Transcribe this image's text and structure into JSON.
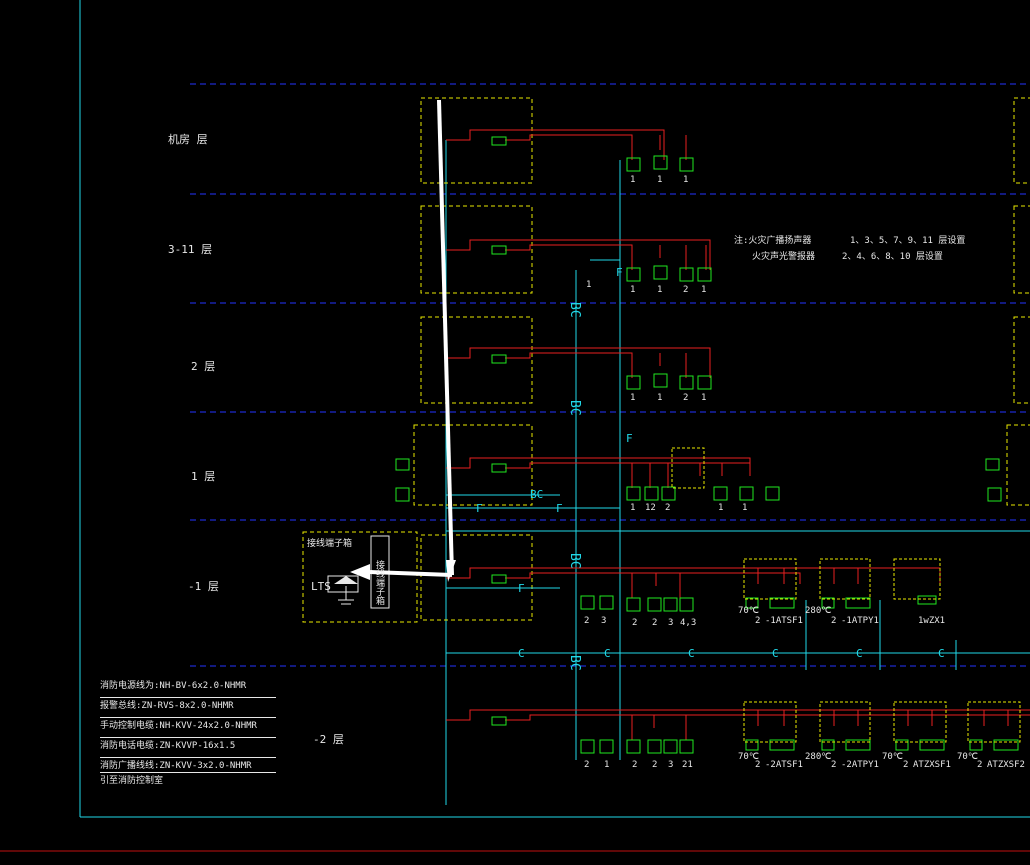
{
  "floors": {
    "roof": "机房  层",
    "f3_11": "3-11  层",
    "f2": "2 层",
    "f1": "1 层",
    "b1": "-1  层",
    "b2": "-2  层"
  },
  "notes": {
    "line1_title": "注:火灾广播扬声器",
    "line1_floors": "1、3、5、7、9、11 层设置",
    "line2_title": "火灾声光警报器",
    "line2_floors": "2、4、6、8、10 层设置"
  },
  "legend": [
    "消防电源线为:NH-BV-6x2.0-NHMR",
    "报警总线:ZN-RVS-8x2.0-NHMR",
    "手动控制电缆:NH-KVV-24x2.0-NHMR",
    "消防电话电缆:ZN-KVVP-16x1.5",
    "消防广播线线:ZN-KVV-3x2.0-NHMR",
    "引至消防控制室"
  ],
  "devices": {
    "terminal_box": "接线端子箱",
    "lts": "LTS",
    "terminal_label": "接线端子箱"
  },
  "riser_labels": [
    "BC",
    "BC",
    "BC",
    "BC"
  ],
  "b1_tags": [
    "1wZX1"
  ],
  "b1_equipment": [
    {
      "temp": "70℃",
      "count": "2",
      "tag": "-1ATSF1"
    },
    {
      "temp": "280℃",
      "count": "2",
      "tag": "-1ATPY1"
    }
  ],
  "b2_equipment": [
    {
      "temp": "70℃",
      "count": "2",
      "tag": "-2ATSF1"
    },
    {
      "temp": "280℃",
      "count": "2",
      "tag": "-2ATPY1"
    },
    {
      "temp": "70℃",
      "count": "2",
      "tag": "ATZXSF1"
    },
    {
      "temp": "70℃",
      "count": "2",
      "tag": "ATZXSF2"
    }
  ],
  "counts": {
    "roof": [
      "1",
      "1",
      "1"
    ],
    "f3_11": [
      "1",
      "1",
      "1",
      "2",
      "1"
    ],
    "f2": [
      "1",
      "1",
      "2",
      "1"
    ],
    "f1": [
      "1",
      "12",
      "2",
      "1",
      "1"
    ],
    "b1": [
      "2",
      "3",
      "2",
      "2",
      "3",
      "4,3"
    ],
    "b2": [
      "2",
      "1",
      "2",
      "2",
      "3",
      "21"
    ]
  },
  "colors": {
    "frame": "#21d8e8",
    "dashed": "#2433ff",
    "box": "#e8e800",
    "wire": "#e82020",
    "device": "#20e820",
    "cyan": "#21d8e8",
    "text": "#e8e8e8"
  }
}
